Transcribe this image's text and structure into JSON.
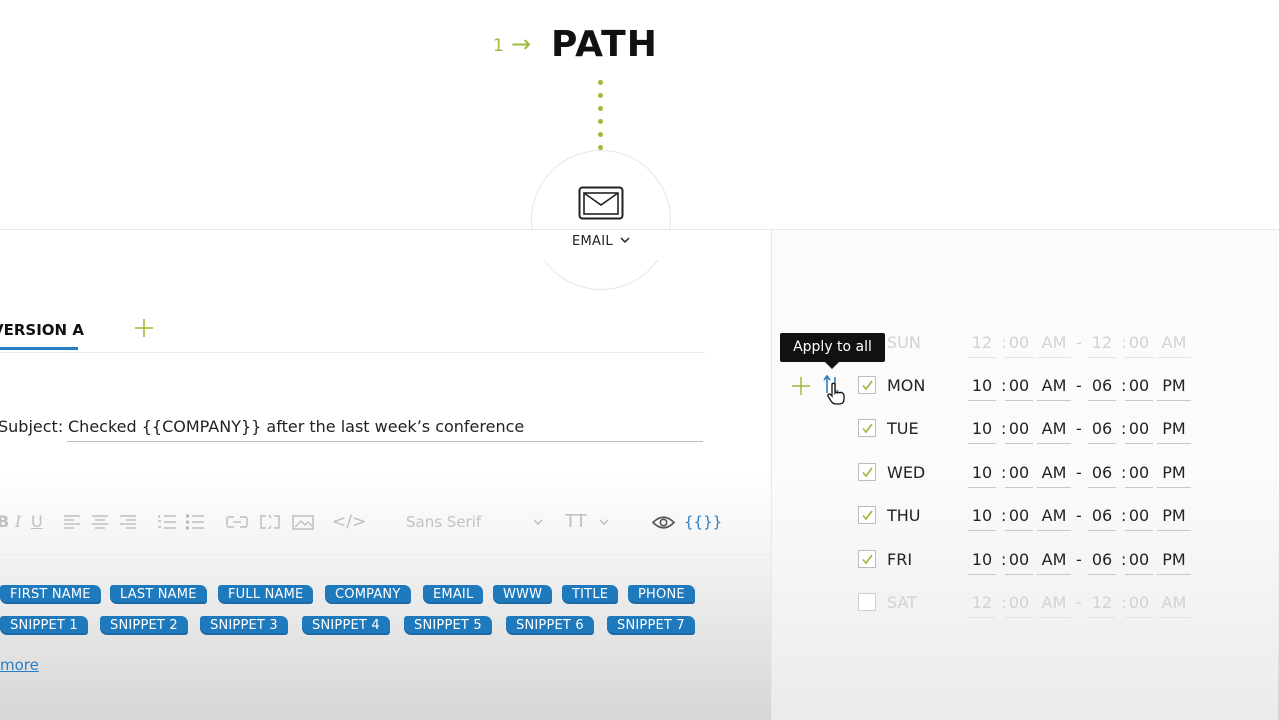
{
  "header": {
    "step_number": "1",
    "arrow": "→",
    "title": "PATH"
  },
  "node": {
    "label": "EMAIL",
    "icon": "envelope-icon"
  },
  "editor": {
    "tabs": [
      {
        "label": "VERSION A",
        "active": true
      }
    ],
    "subject_label": "Subject:",
    "subject_value": "Checked {{COMPANY}} after the last week’s conference",
    "toolbar": {
      "font_family": "Sans Serif",
      "variables_symbol": "{{}}"
    },
    "tags_row1": [
      "FIRST NAME",
      "LAST NAME",
      "FULL NAME",
      "COMPANY",
      "EMAIL",
      "WWW",
      "TITLE",
      "PHONE"
    ],
    "tags_row2": [
      "SNIPPET 1",
      "SNIPPET 2",
      "SNIPPET 3",
      "SNIPPET 4",
      "SNIPPET 5",
      "SNIPPET 6",
      "SNIPPET 7"
    ],
    "more_link": "more"
  },
  "schedule": {
    "tooltip": "Apply to all",
    "days": [
      {
        "day": "SUN",
        "enabled": false,
        "start_h": "12",
        "start_m": "00",
        "start_ampm": "AM",
        "dash": "-",
        "end_h": "12",
        "end_m": "00",
        "end_ampm": "AM"
      },
      {
        "day": "MON",
        "enabled": true,
        "start_h": "10",
        "start_m": "00",
        "start_ampm": "AM",
        "dash": "-",
        "end_h": "06",
        "end_m": "00",
        "end_ampm": "PM"
      },
      {
        "day": "TUE",
        "enabled": true,
        "start_h": "10",
        "start_m": "00",
        "start_ampm": "AM",
        "dash": "-",
        "end_h": "06",
        "end_m": "00",
        "end_ampm": "PM"
      },
      {
        "day": "WED",
        "enabled": true,
        "start_h": "10",
        "start_m": "00",
        "start_ampm": "AM",
        "dash": "-",
        "end_h": "06",
        "end_m": "00",
        "end_ampm": "PM"
      },
      {
        "day": "THU",
        "enabled": true,
        "start_h": "10",
        "start_m": "00",
        "start_ampm": "AM",
        "dash": "-",
        "end_h": "06",
        "end_m": "00",
        "end_ampm": "PM"
      },
      {
        "day": "FRI",
        "enabled": true,
        "start_h": "10",
        "start_m": "00",
        "start_ampm": "AM",
        "dash": "-",
        "end_h": "06",
        "end_m": "00",
        "end_ampm": "PM"
      },
      {
        "day": "SAT",
        "enabled": false,
        "start_h": "12",
        "start_m": "00",
        "start_ampm": "AM",
        "dash": "-",
        "end_h": "12",
        "end_m": "00",
        "end_ampm": "AM"
      }
    ]
  },
  "colors": {
    "accent_green": "#9bbb3b",
    "tag_blue": "#1f79bd",
    "tab_underline_blue": "#2a7fc4"
  }
}
